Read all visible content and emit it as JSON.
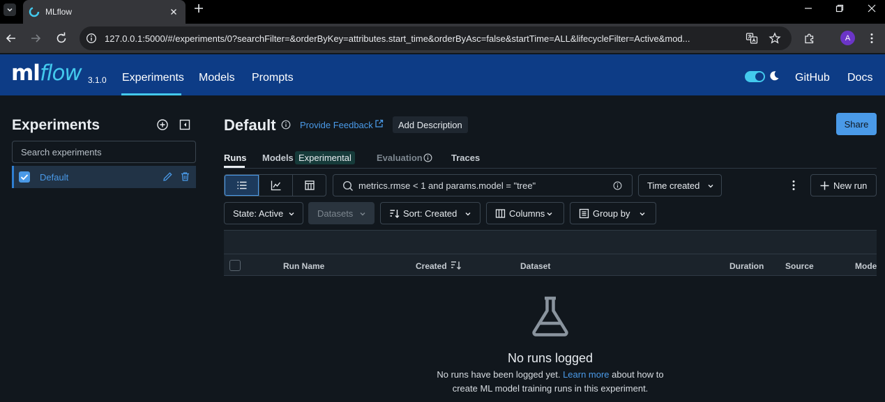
{
  "browser": {
    "tab_title": "MLflow",
    "url": "127.0.0.1:5000/#/experiments/0?searchFilter=&orderByKey=attributes.start_time&orderByAsc=false&startTime=ALL&lifecycleFilter=Active&mod...",
    "avatar_initial": "A"
  },
  "header": {
    "logo_ml": "ml",
    "logo_flow": "flow",
    "version": "3.1.0",
    "nav": [
      "Experiments",
      "Models",
      "Prompts"
    ],
    "github": "GitHub",
    "docs": "Docs"
  },
  "sidebar": {
    "title": "Experiments",
    "search_placeholder": "Search experiments",
    "items": [
      {
        "label": "Default"
      }
    ]
  },
  "main": {
    "title": "Default",
    "feedback": "Provide Feedback",
    "add_description": "Add Description",
    "share": "Share",
    "tabs": [
      "Runs",
      "Models",
      "Evaluation",
      "Traces"
    ],
    "experimental_badge": "Experimental",
    "search_value": "metrics.rmse < 1 and params.model = \"tree\"",
    "time_select": "Time created",
    "new_run": "New run",
    "filters": {
      "state": "State: Active",
      "datasets": "Datasets",
      "sort": "Sort: Created",
      "columns": "Columns",
      "group_by": "Group by"
    },
    "columns": [
      "Run Name",
      "Created",
      "Dataset",
      "Duration",
      "Source",
      "Mode"
    ],
    "empty": {
      "title": "No runs logged",
      "text_before": "No runs have been logged yet. ",
      "link": "Learn more",
      "text_after": " about how to create ML model training runs in this experiment."
    }
  },
  "colors": {
    "header_bg": "#0d3c86",
    "accent": "#4a9ae8",
    "page_bg": "#11171d"
  }
}
